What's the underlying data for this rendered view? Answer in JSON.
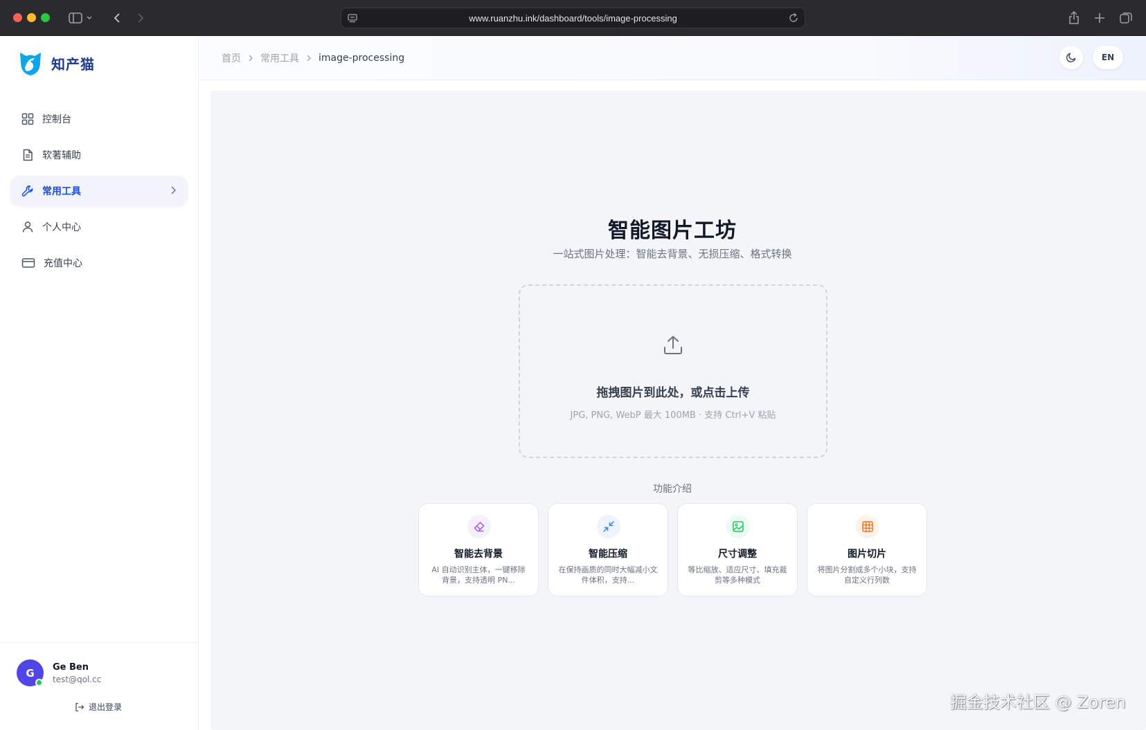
{
  "browser": {
    "url": "www.ruanzhu.ink/dashboard/tools/image-processing"
  },
  "sidebar": {
    "logo_text": "知产猫",
    "items": [
      {
        "label": "控制台",
        "icon": "grid-icon"
      },
      {
        "label": "软著辅助",
        "icon": "document-icon"
      },
      {
        "label": "常用工具",
        "icon": "wrench-icon",
        "active": true
      },
      {
        "label": "个人中心",
        "icon": "user-icon"
      },
      {
        "label": "充值中心",
        "icon": "credit-card-icon"
      }
    ],
    "user": {
      "avatar_letter": "G",
      "name": "Ge Ben",
      "email": "test@qol.cc"
    },
    "logout_label": "退出登录"
  },
  "header": {
    "breadcrumb": [
      "首页",
      "常用工具",
      "image-processing"
    ],
    "lang_label": "EN"
  },
  "main": {
    "title": "智能图片工坊",
    "subtitle": "一站式图片处理：智能去背景、无损压缩、格式转换",
    "dropzone": {
      "main_text": "拖拽图片到此处，或点击上传",
      "hint": "JPG, PNG, WebP 最大 100MB · 支持 Ctrl+V 粘贴"
    },
    "features_title": "功能介绍",
    "features": [
      {
        "title": "智能去背景",
        "desc": "AI 自动识别主体，一键移除背景，支持透明 PN...",
        "icon": "eraser-icon",
        "color": "#a855f7",
        "bg": "#f5f0fd"
      },
      {
        "title": "智能压缩",
        "desc": "在保持画质的同时大幅减小文件体积，支持...",
        "icon": "compress-icon",
        "color": "#3b82f6",
        "bg": "#eef4fe"
      },
      {
        "title": "尺寸调整",
        "desc": "等比缩放、适应尺寸、填充裁剪等多种模式",
        "icon": "image-icon",
        "color": "#22c55e",
        "bg": "#ecfbf1"
      },
      {
        "title": "图片切片",
        "desc": "将图片分割成多个小块，支持自定义行列数",
        "icon": "grid-slice-icon",
        "color": "#f97316",
        "bg": "#fef3ea"
      }
    ]
  },
  "watermark": "掘金技术社区 @ Zoren"
}
